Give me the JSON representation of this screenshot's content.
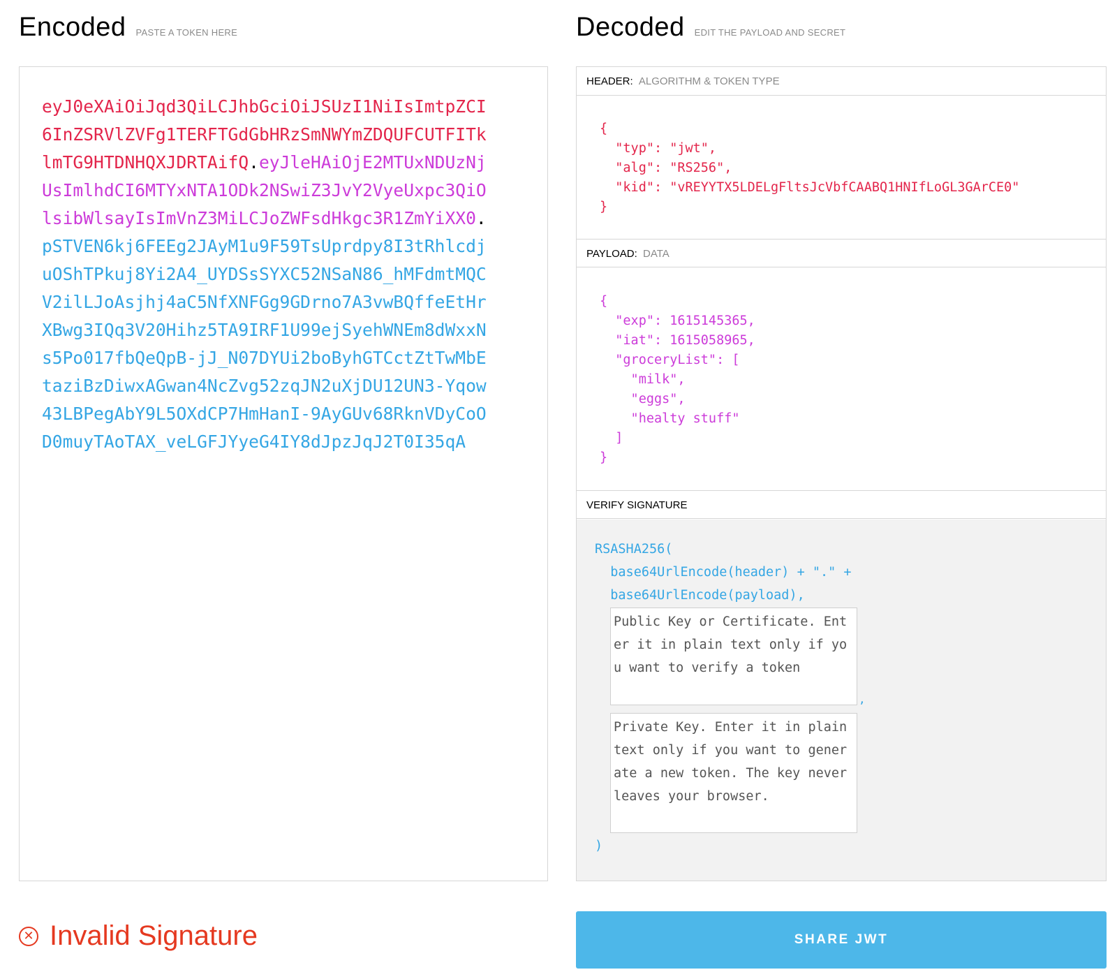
{
  "encoded": {
    "title": "Encoded",
    "subtitle": "PASTE A TOKEN HERE",
    "token_header": "eyJ0eXAiOiJqd3QiLCJhbGciOiJSUzI1NiIsImtpZCI6InZSRVlZVFg1TERFTGdGbHRzSmNWYmZDQUFCUTFITklmTG9HTDNHQXJDRTAifQ",
    "token_payload": "eyJleHAiOjE2MTUxNDUzNjUsImlhdCI6MTYxNTA1ODk2NSwiZ3JvY2VyeUxpc3QiOlsibWlsayIsImVnZ3MiLCJoZWFsdHkgc3R1ZmYiXX0",
    "token_signature": "pSTVEN6kj6FEEg2JAyM1u9F59TsUprdpy8I3tRhlcdjuOShTPkuj8Yi2A4_UYDSsSYXC52NSaN86_hMFdmtMQCV2ilLJoAsjhj4aC5NfXNFGg9GDrno7A3vwBQffeEtHrXBwg3IQq3V20Hihz5TA9IRF1U99ejSyehWNEm8dWxxNs5Po017fbQeQpB-jJ_N07DYUi2boByhGTCctZtTwMbEtaziBzDiwxAGwan4NcZvg52zqJN2uXjDU12UN3-Yqow43LBPegAbY9L5OXdCP7HmHanI-9AyGUv68RknVDyCoOD0muyTAoTAX_veLGFJYyeG4IY8dJpzJqJ2T0I35qA",
    "dot": "."
  },
  "decoded": {
    "title": "Decoded",
    "subtitle": "EDIT THE PAYLOAD AND SECRET",
    "header_section": {
      "label": "HEADER:",
      "description": "ALGORITHM & TOKEN TYPE",
      "json": "{\n  \"typ\": \"jwt\",\n  \"alg\": \"RS256\",\n  \"kid\": \"vREYYTX5LDELgFltsJcVbfCAABQ1HNIfLoGL3GArCE0\"\n}"
    },
    "payload_section": {
      "label": "PAYLOAD:",
      "description": "DATA",
      "json": "{\n  \"exp\": 1615145365,\n  \"iat\": 1615058965,\n  \"groceryList\": [\n    \"milk\",\n    \"eggs\",\n    \"healty stuff\"\n  ]\n}"
    },
    "verify_section": {
      "label": "VERIFY SIGNATURE",
      "line1": "RSASHA256(",
      "line2": "  base64UrlEncode(header) + \".\" +",
      "line3": "  base64UrlEncode(payload),",
      "comma": ",",
      "closing": ")",
      "public_key_placeholder": "Public Key or Certificate. Enter it in plain text only if you want to verify a token",
      "private_key_placeholder": "Private Key. Enter it in plain text only if you want to generate a new token. The key never leaves your browser."
    }
  },
  "status": {
    "icon": "close-circle-icon",
    "icon_glyph": "✕",
    "text": "Invalid Signature",
    "color": "#e53920"
  },
  "share_button": {
    "label": "SHARE JWT",
    "color": "#4db7e9"
  },
  "colors": {
    "header": "#e3254b",
    "payload": "#cc3bd9",
    "signature": "#34a6e4"
  }
}
